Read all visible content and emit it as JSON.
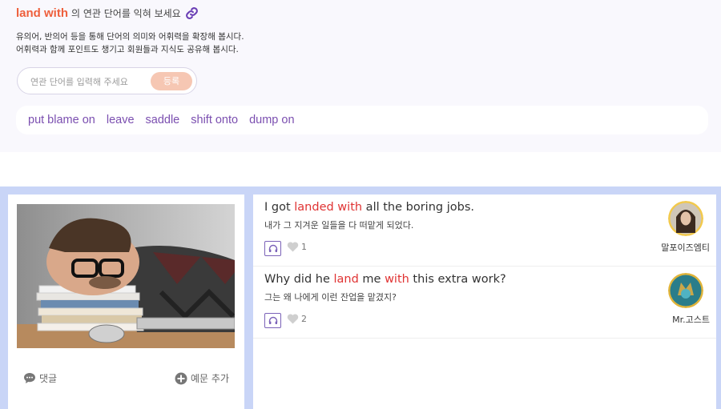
{
  "header": {
    "keyword": "land with",
    "title_suffix": "의 연관 단어를 익혀 보세요",
    "link_icon": "link-icon",
    "desc_line1": "유의어, 반의어 등을 통해 단어의 의미와 어휘력을 확장해 봅시다.",
    "desc_line2": "어휘력과 함께 포인트도 챙기고 회원들과 지식도 공유해 봅시다."
  },
  "form": {
    "placeholder": "연관 단어를 입력해 주세요",
    "value": "",
    "submit_label": "등록"
  },
  "related_words": [
    "put blame on",
    "leave",
    "saddle",
    "shift onto",
    "dump on"
  ],
  "image_card": {
    "comment_label": "댓글",
    "add_example_label": "예문 추가",
    "comment_icon": "speech-bubble-icon",
    "add_icon": "plus-circle-icon"
  },
  "examples": [
    {
      "en_before": "I got ",
      "en_hl1": "landed with",
      "en_mid": "",
      "en_hl2": "",
      "en_after": " all the boring jobs.",
      "ko": "내가 그 지겨운 일들을 다 떠맡게 되었다.",
      "likes": "1",
      "user": "말포이즈엠티"
    },
    {
      "en_before": "Why did he ",
      "en_hl1": "land",
      "en_mid": " me ",
      "en_hl2": "with",
      "en_after": " this extra work?",
      "ko": "그는 왜 나에게 이런 잔업을 맡겼지?",
      "likes": "2",
      "user": "Mr.고스트"
    }
  ],
  "colors": {
    "keyword": "#ee5f3c",
    "related_word": "#7b4fb0",
    "highlight": "#e03333",
    "bottom_bg": "#c9d5f7",
    "top_bg": "#f9f8fd"
  }
}
